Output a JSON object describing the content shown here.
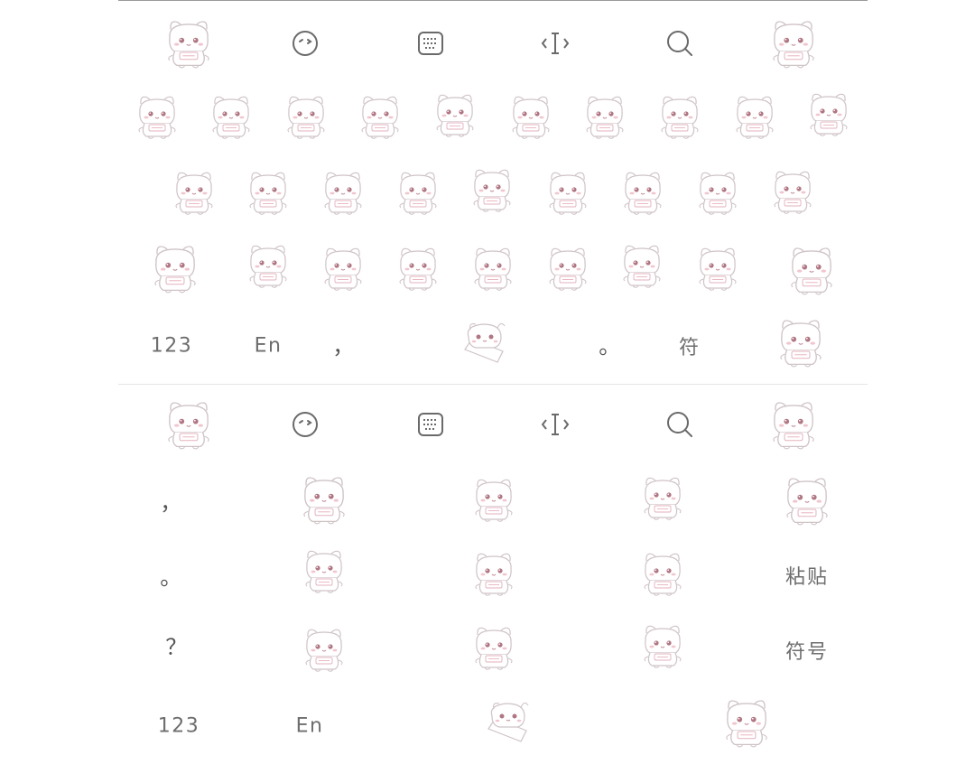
{
  "keyboard_top": {
    "toolbar": [
      "bear-icon",
      "emoji-icon",
      "keyboard-icon",
      "text-cursor-icon",
      "search-icon",
      "bear-icon"
    ],
    "bottom_row": {
      "numbers_label": "123",
      "english_label": "En",
      "comma_label": "，",
      "period_label": "。",
      "symbols_label": "符"
    }
  },
  "keyboard_bottom": {
    "left_column": {
      "comma": "，",
      "period": "。",
      "question": "？"
    },
    "paste_label": "粘贴",
    "symbols_label": "符号",
    "numbers_label": "123",
    "english_label": "En"
  },
  "colors": {
    "bear_outline": "#cfc3c6",
    "bear_blush": "#e7a9b6",
    "bear_eye": "#b07683",
    "icon_stroke": "#6a6a6a",
    "text": "#6e6e6e"
  }
}
